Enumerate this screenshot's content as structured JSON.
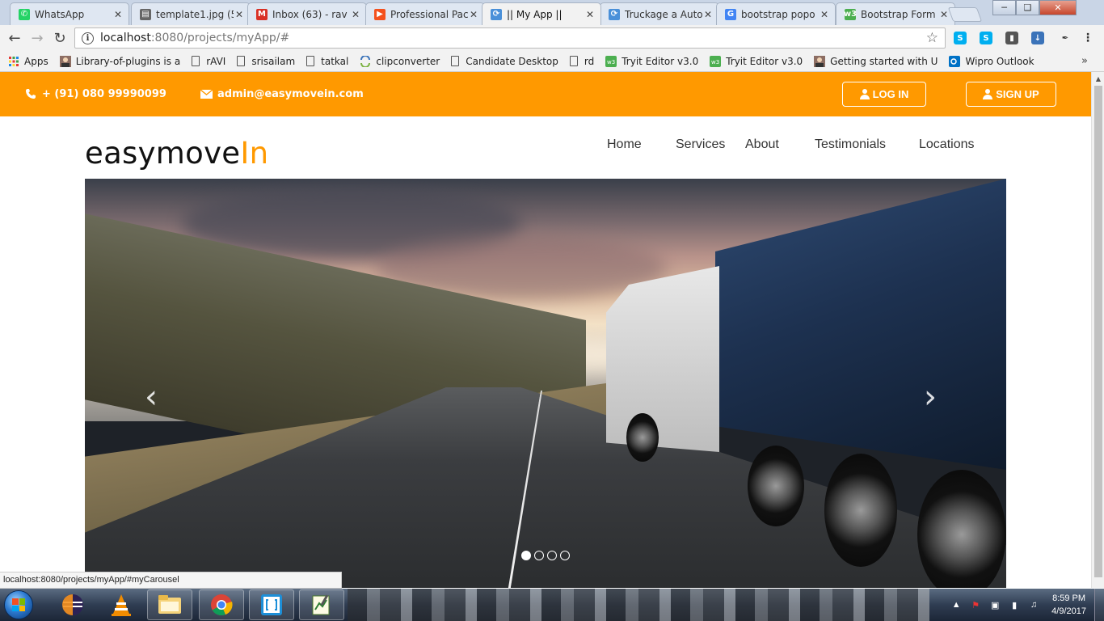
{
  "browser": {
    "tabs": [
      {
        "title": "WhatsApp",
        "icon": "whatsapp-icon",
        "color": "#25d366"
      },
      {
        "title": "template1.jpg (5",
        "icon": "document-icon",
        "color": "#666666"
      },
      {
        "title": "Inbox (63) - rav",
        "icon": "gmail-icon",
        "color": "#d93025"
      },
      {
        "title": "Professional Pac",
        "icon": "play-icon",
        "color": "#f4511e"
      },
      {
        "title": "|| My App ||",
        "icon": "spinner-icon",
        "color": "#4a90d9",
        "active": true
      },
      {
        "title": "Truckage a Auto",
        "icon": "spinner-icon",
        "color": "#4a90d9"
      },
      {
        "title": "bootstrap popo",
        "icon": "google-icon",
        "color": "#4285f4"
      },
      {
        "title": "Bootstrap Form",
        "icon": "w3-icon",
        "color": "#4caf50"
      }
    ],
    "url_host": "localhost",
    "url_path": ":8080/projects/myApp/#",
    "bookmarks": [
      {
        "label": "Apps",
        "icon": "apps-grid-icon"
      },
      {
        "label": "Library-of-plugins is a",
        "icon": "avatar-icon"
      },
      {
        "label": "rAVI",
        "icon": "page-icon"
      },
      {
        "label": "srisailam",
        "icon": "page-icon"
      },
      {
        "label": "tatkal",
        "icon": "page-icon"
      },
      {
        "label": "clipconverter",
        "icon": "convert-icon"
      },
      {
        "label": "Candidate Desktop",
        "icon": "page-icon"
      },
      {
        "label": "rd",
        "icon": "page-icon"
      },
      {
        "label": "Tryit Editor v3.0",
        "icon": "w3-icon"
      },
      {
        "label": "Tryit Editor v3.0",
        "icon": "w3-icon"
      },
      {
        "label": "Getting started with U",
        "icon": "avatar-icon"
      },
      {
        "label": "Wipro Outlook",
        "icon": "outlook-icon"
      }
    ],
    "bookmarks_more": "»",
    "status_url": "localhost:8080/projects/myApp/#myCarousel"
  },
  "site": {
    "phone": "+ (91) 080 99990099",
    "email": "admin@easymovein.com",
    "login_label": "LOG IN",
    "signup_label": "SIGN UP",
    "logo_main": "easymove",
    "logo_accent": "In",
    "nav": [
      "Home",
      "Services",
      "About",
      "Testimonials",
      "Locations"
    ],
    "carousel": {
      "slides": 4,
      "active_slide": 1,
      "prev_glyph": "‹",
      "next_glyph": "›"
    }
  },
  "colors": {
    "accent": "#ff9900",
    "topbar_text": "#ffffff"
  },
  "taskbar": {
    "apps": [
      "start-button",
      "eclipse-icon",
      "vlc-icon",
      "file-explorer-icon",
      "chrome-icon",
      "brackets-icon",
      "notepad-icon"
    ],
    "time": "8:59 PM",
    "date": "4/9/2017"
  }
}
